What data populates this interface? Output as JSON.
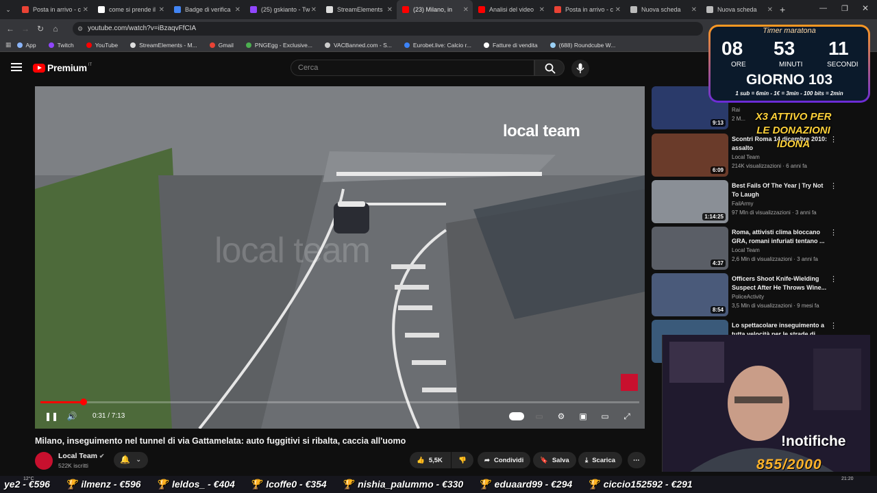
{
  "browser": {
    "tabs": [
      {
        "label": "Posta in arrivo - c",
        "color": "#ea4335"
      },
      {
        "label": "come si prende il",
        "color": "#ffffff"
      },
      {
        "label": "Badge di verifica",
        "color": "#4285f4"
      },
      {
        "label": "(25) gskianto - Tw",
        "color": "#9146ff"
      },
      {
        "label": "StreamElements",
        "color": "#dddddd"
      },
      {
        "label": "(23) Milano, in",
        "color": "#ff0000",
        "active": true
      },
      {
        "label": "Analisi del video",
        "color": "#ff0000"
      },
      {
        "label": "Posta in arrivo - c",
        "color": "#ea4335"
      },
      {
        "label": "Nuova scheda",
        "color": "#bbbbbb"
      },
      {
        "label": "Nuova scheda",
        "color": "#bbbbbb"
      }
    ],
    "url": "youtube.com/watch?v=iBzaqvFfCIA",
    "bookmarks": [
      {
        "label": "App",
        "color": "#8ab4f8"
      },
      {
        "label": "Twitch",
        "color": "#9146ff"
      },
      {
        "label": "YouTube",
        "color": "#ff0000"
      },
      {
        "label": "StreamElements - M...",
        "color": "#dddddd"
      },
      {
        "label": "Gmail",
        "color": "#ea4335"
      },
      {
        "label": "PNGEgg - Exclusive...",
        "color": "#4caf50"
      },
      {
        "label": "VACBanned.com - S...",
        "color": "#cccccc"
      },
      {
        "label": "Eurobet.live: Calcio r...",
        "color": "#3b82f6"
      },
      {
        "label": "Fatture di vendita",
        "color": "#ffffff"
      },
      {
        "label": "(688) Roundcube W...",
        "color": "#9ad0f5"
      }
    ]
  },
  "youtube": {
    "logo_word": "Premium",
    "logo_country": "IT",
    "search_placeholder": "Cerca",
    "video": {
      "brand_overlay": "local team",
      "watermark": "local team",
      "time": "0:31 / 7:13",
      "progress_fraction": 0.072
    },
    "title": "Milano, inseguimento nel tunnel di via Gattamelata: auto fuggitivi si ribalta, caccia all'uomo",
    "channel": "Local Team",
    "subscribers": "522K iscritti",
    "actions": {
      "likes": "5,5K",
      "share": "Condividi",
      "save": "Salva",
      "download": "Scarica"
    },
    "recommendations": [
      {
        "title": "",
        "channel": "Rai",
        "views": "2 M...",
        "duration": "9:13",
        "color": "#2a3a6a"
      },
      {
        "title": "Scontri Roma 14 dicembre 2010: assalto",
        "channel": "Local Team",
        "views": "214K visualizzazioni · 6 anni fa",
        "duration": "6:09",
        "color": "#6a3b2a"
      },
      {
        "title": "Best Fails Of The Year | Try Not To Laugh",
        "channel": "FailArmy",
        "views": "97 Mln di visualizzazioni · 3 anni fa",
        "duration": "1:14:25",
        "color": "#8a8f96"
      },
      {
        "title": "Roma, attivisti clima bloccano GRA, romani infuriati tentano ...",
        "channel": "Local Team",
        "views": "2,6 Mln di visualizzazioni · 3 anni fa",
        "duration": "4:37",
        "color": "#5a5e66"
      },
      {
        "title": "Officers Shoot Knife-Wielding Suspect After He Throws Wine...",
        "channel": "PoliceActivity",
        "views": "3,5 Mln di visualizzazioni · 9 mesi fa",
        "duration": "8:54",
        "color": "#4a5a7a"
      },
      {
        "title": "Lo spettacolare inseguimento a tutta velocità per le strade di",
        "channel": "",
        "views": "",
        "duration": "",
        "color": "#3a5a7a"
      }
    ]
  },
  "stream": {
    "timer_label": "Timer maratona",
    "hours": "08",
    "minutes": "53",
    "seconds": "11",
    "hours_label": "ORE",
    "minutes_label": "MINUTI",
    "seconds_label": "SECONDI",
    "day": "GIORNO 103",
    "rates": "1 sub = 6min - 1€ = 3min - 100 bits = 2min",
    "x3_line1": "X3 ATTIVO PER",
    "x3_line2": "LE DONAZIONI",
    "x3_line3": "IDONA",
    "command": "!notifiche",
    "goal": "855/2000",
    "ticker": [
      "ye2 - €596",
      "ilmenz - €596",
      "leldos_ - €404",
      "lcoffe0 - €354",
      "nishia_palummo - €330",
      "eduaard99 - €294",
      "ciccio152592 - €291"
    ],
    "clock_time": "21:20",
    "weather": "12°C"
  }
}
